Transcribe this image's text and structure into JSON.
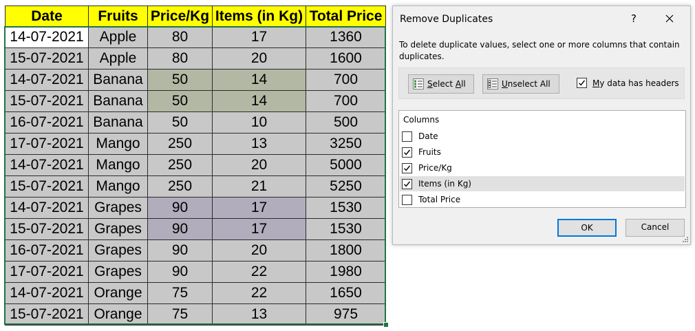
{
  "sheet": {
    "headers": [
      "Date",
      "Fruits",
      "Price/Kg",
      "Items (in Kg)",
      "Total Price"
    ],
    "rows": [
      [
        "14-07-2021",
        "Apple",
        "80",
        "17",
        "1360"
      ],
      [
        "15-07-2021",
        "Apple",
        "80",
        "20",
        "1600"
      ],
      [
        "14-07-2021",
        "Banana",
        "50",
        "14",
        "700"
      ],
      [
        "15-07-2021",
        "Banana",
        "50",
        "14",
        "700"
      ],
      [
        "16-07-2021",
        "Banana",
        "50",
        "10",
        "500"
      ],
      [
        "17-07-2021",
        "Mango",
        "250",
        "13",
        "3250"
      ],
      [
        "14-07-2021",
        "Mango",
        "250",
        "20",
        "5000"
      ],
      [
        "15-07-2021",
        "Mango",
        "250",
        "21",
        "5250"
      ],
      [
        "14-07-2021",
        "Grapes",
        "90",
        "17",
        "1530"
      ],
      [
        "15-07-2021",
        "Grapes",
        "90",
        "17",
        "1530"
      ],
      [
        "16-07-2021",
        "Grapes",
        "90",
        "20",
        "1800"
      ],
      [
        "17-07-2021",
        "Grapes",
        "90",
        "22",
        "1980"
      ],
      [
        "14-07-2021",
        "Orange",
        "75",
        "22",
        "1650"
      ],
      [
        "15-07-2021",
        "Orange",
        "75",
        "13",
        "975"
      ]
    ],
    "colors": {
      "header_bg": "#ffff00",
      "selected_bg": "#c8c8c8",
      "duplicate_highlight_1": "#b3b8a4",
      "duplicate_highlight_2": "#b2adbc",
      "selection_border": "#217346"
    }
  },
  "dialog": {
    "title": "Remove Duplicates",
    "help_label": "?",
    "description": "To delete duplicate values, select one or more columns that contain duplicates.",
    "select_all": {
      "pre": "",
      "accel": "S",
      "post": "elect ",
      "accel2": "A",
      "post2": "ll"
    },
    "unselect_all": {
      "accel": "U",
      "post": "nselect All"
    },
    "headers_checkbox": {
      "accel": "M",
      "post": "y data has headers",
      "checked": true
    },
    "columns_label": "Columns",
    "columns": [
      {
        "label": "Date",
        "checked": false
      },
      {
        "label": "Fruits",
        "checked": true
      },
      {
        "label": "Price/Kg",
        "checked": true
      },
      {
        "label": "Items (in Kg)",
        "checked": true
      },
      {
        "label": "Total Price",
        "checked": false
      }
    ],
    "ok_label": "OK",
    "cancel_label": "Cancel",
    "icons": {
      "close": "close-icon",
      "select_all": "select-all-icon",
      "unselect_all": "unselect-all-icon",
      "grip": "resize-grip-icon"
    }
  }
}
